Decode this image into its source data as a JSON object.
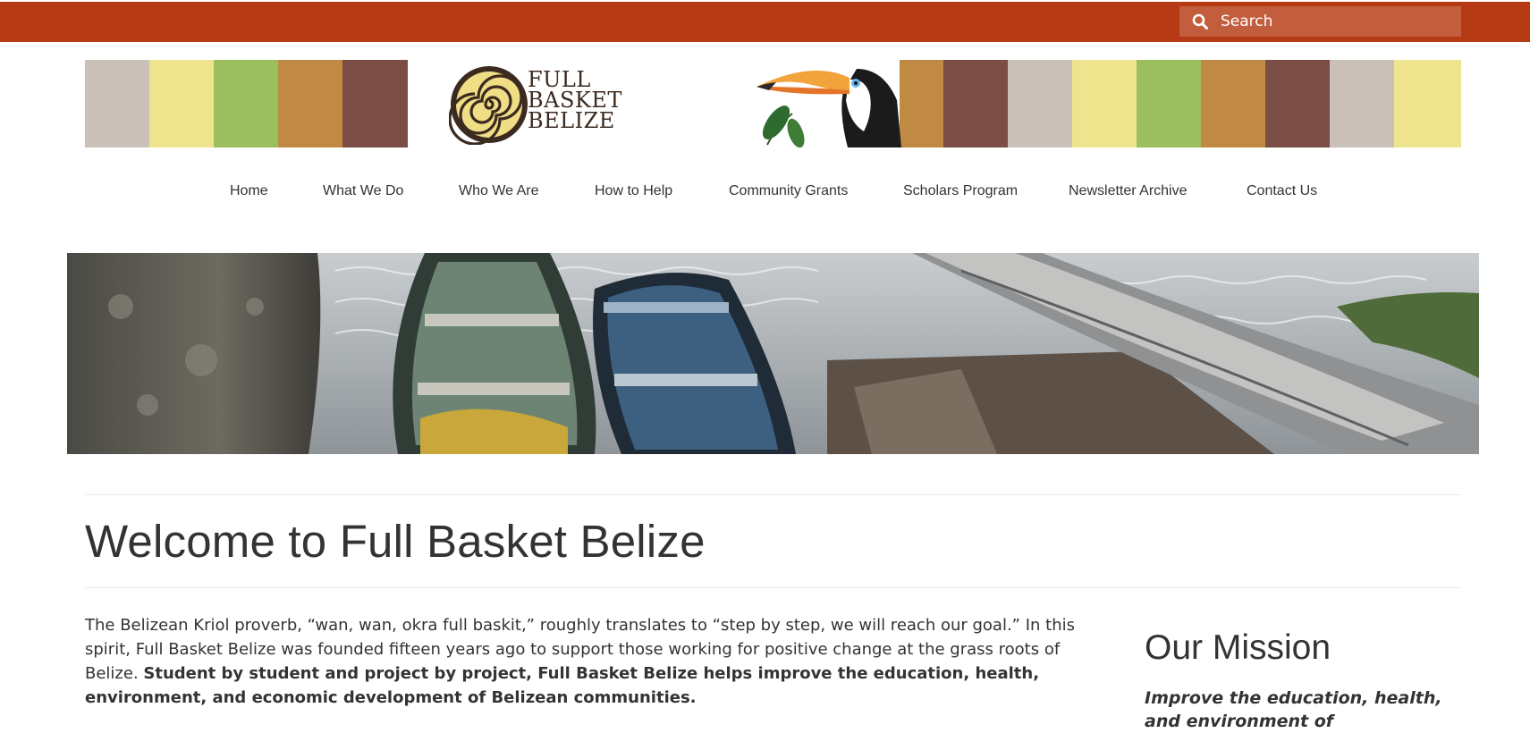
{
  "colors": {
    "brand": "#b53a14",
    "text": "#333333"
  },
  "search": {
    "placeholder": "Search",
    "icon": "search-icon"
  },
  "logo": {
    "line1": "FULL",
    "line2": "BASKET",
    "line3": "BELIZE"
  },
  "nav": {
    "items": [
      {
        "label": "Home"
      },
      {
        "label": "What We Do"
      },
      {
        "label": "Who We Are"
      },
      {
        "label": "How to Help"
      },
      {
        "label": "Community Grants"
      },
      {
        "label": "Scholars Program"
      },
      {
        "label": "Newsletter Archive"
      },
      {
        "label": "Contact Us"
      }
    ]
  },
  "page": {
    "title": "Welcome to Full Basket Belize"
  },
  "intro": {
    "text": "The Belizean Kriol proverb, “wan, wan, okra full baskit,” roughly translates to “step by step, we will reach our goal.”  In this spirit, Full Basket Belize was founded fifteen years ago to support those working for positive change at the grass roots of Belize. ",
    "bold": "Student by student and project by project, Full Basket Belize helps improve the education, health, environment, and economic development of Belizean communities."
  },
  "sidebar": {
    "title": "Our Mission",
    "text": "Improve the education, health, and environment of"
  }
}
